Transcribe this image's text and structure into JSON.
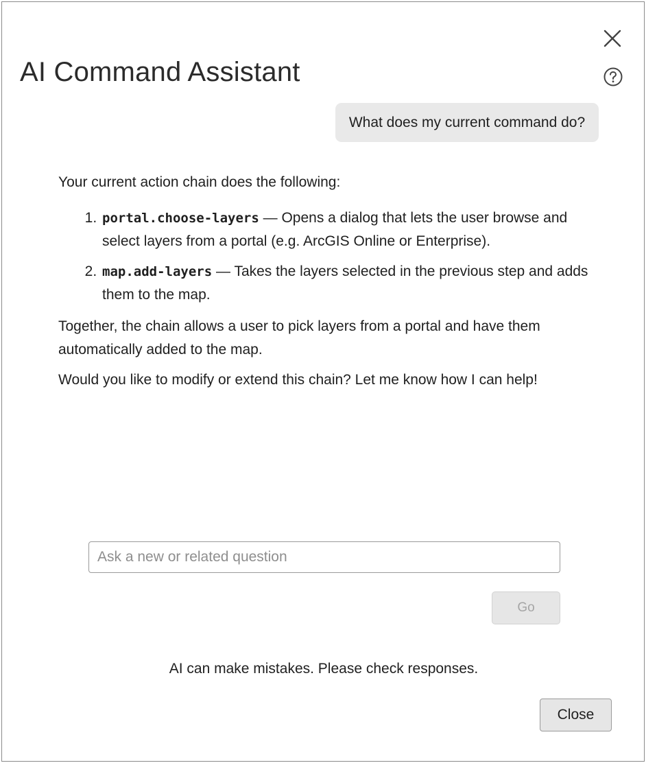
{
  "dialog": {
    "title": "AI Command Assistant",
    "close_icon": "close-icon",
    "help_icon": "help-icon"
  },
  "conversation": {
    "user_message": "What does my current command do?",
    "response": {
      "intro": "Your current action chain does the following:",
      "steps": [
        {
          "command": "portal.choose-layers",
          "description": " — Opens a dialog that lets the user browse and select layers from a portal (e.g. ArcGIS Online or Enterprise)."
        },
        {
          "command": "map.add-layers",
          "description": " — Takes the layers selected in the previous step and adds them to the map."
        }
      ],
      "summary": "Together, the chain allows a user to pick layers from a portal and have them automatically added to the map.",
      "followup": "Would you like to modify or extend this chain? Let me know how I can help!"
    }
  },
  "input": {
    "value": "",
    "placeholder": "Ask a new or related question"
  },
  "buttons": {
    "go_label": "Go",
    "close_label": "Close"
  },
  "disclaimer": "AI can make mistakes. Please check responses.",
  "colors": {
    "bubble_background": "#e9e9e9",
    "button_background": "#e6e6e6",
    "disabled_text": "#a5a5a5",
    "border": "#9a9a9a"
  }
}
